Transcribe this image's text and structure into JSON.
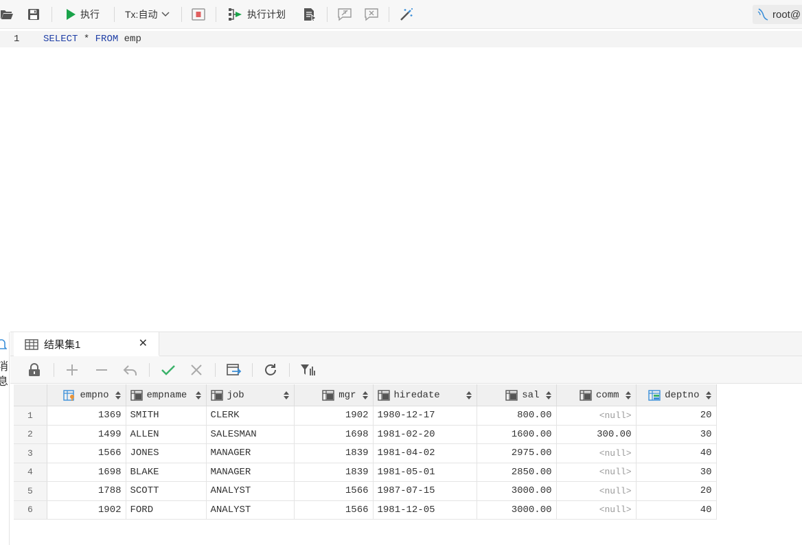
{
  "toolbar": {
    "run_label": "执行",
    "tx_label": "Tx:自动",
    "plan_label": "执行计划",
    "user_label": "root@"
  },
  "editor": {
    "line_number": "1",
    "sql_keyword1": "SELECT",
    "sql_star": "*",
    "sql_keyword2": "FROM",
    "sql_table": "emp"
  },
  "side_panel": {
    "messages_label": "消息"
  },
  "result_tab": {
    "title": "结果集1",
    "close": "✕"
  },
  "grid": {
    "columns": [
      {
        "name": "empno",
        "icon": "key-column-icon"
      },
      {
        "name": "empname",
        "icon": "column-icon"
      },
      {
        "name": "job",
        "icon": "column-icon"
      },
      {
        "name": "mgr",
        "icon": "column-icon"
      },
      {
        "name": "hiredate",
        "icon": "column-icon"
      },
      {
        "name": "sal",
        "icon": "column-icon"
      },
      {
        "name": "comm",
        "icon": "column-icon"
      },
      {
        "name": "deptno",
        "icon": "foreign-key-column-icon"
      }
    ],
    "rows": [
      {
        "rn": "1",
        "empno": "1369",
        "empname": "SMITH",
        "job": "CLERK",
        "mgr": "1902",
        "hiredate": "1980-12-17",
        "sal": "800.00",
        "comm": "<null>",
        "deptno": "20"
      },
      {
        "rn": "2",
        "empno": "1499",
        "empname": "ALLEN",
        "job": "SALESMAN",
        "mgr": "1698",
        "hiredate": "1981-02-20",
        "sal": "1600.00",
        "comm": "300.00",
        "deptno": "30"
      },
      {
        "rn": "3",
        "empno": "1566",
        "empname": "JONES",
        "job": "MANAGER",
        "mgr": "1839",
        "hiredate": "1981-04-02",
        "sal": "2975.00",
        "comm": "<null>",
        "deptno": "40"
      },
      {
        "rn": "4",
        "empno": "1698",
        "empname": "BLAKE",
        "job": "MANAGER",
        "mgr": "1839",
        "hiredate": "1981-05-01",
        "sal": "2850.00",
        "comm": "<null>",
        "deptno": "30"
      },
      {
        "rn": "5",
        "empno": "1788",
        "empname": "SCOTT",
        "job": "ANALYST",
        "mgr": "1566",
        "hiredate": "1987-07-15",
        "sal": "3000.00",
        "comm": "<null>",
        "deptno": "20"
      },
      {
        "rn": "6",
        "empno": "1902",
        "empname": "FORD",
        "job": "ANALYST",
        "mgr": "1566",
        "hiredate": "1981-12-05",
        "sal": "3000.00",
        "comm": "<null>",
        "deptno": "40"
      }
    ]
  },
  "colors": {
    "run_green": "#1aa34a",
    "keyword_blue": "#1f3fa6",
    "stop_red": "#e06060",
    "confirm_green": "#3bb26a"
  }
}
